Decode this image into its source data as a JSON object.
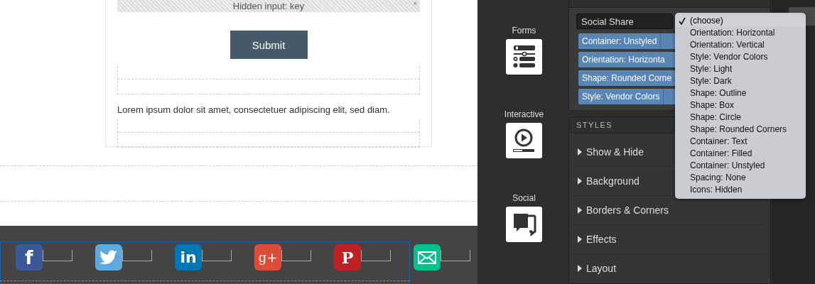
{
  "canvas": {
    "hidden_input": {
      "label": "Hidden input: key",
      "required_mark": "*"
    },
    "submit_button": "Submit",
    "paragraph": "Lorem ipsum dolor sit amet, consectetuer adipiscing elit, sed diam.",
    "social_buttons": [
      {
        "kind": "facebook",
        "color": "#3b5998",
        "glyph": "f"
      },
      {
        "kind": "twitter",
        "color": "#5ea9dd"
      },
      {
        "kind": "linkedin",
        "color": "#0077b5",
        "glyph": "in"
      },
      {
        "kind": "googleplus",
        "color": "#dd4b39",
        "glyph": "g+"
      },
      {
        "kind": "pinterest",
        "color": "#bd2126",
        "glyph": "P"
      },
      {
        "kind": "email",
        "color": "#00c18c"
      }
    ]
  },
  "widgets": [
    {
      "label": "Forms",
      "kind": "forms"
    },
    {
      "label": "Interactive",
      "kind": "interactive"
    },
    {
      "label": "Social",
      "kind": "social"
    }
  ],
  "micro_themes": {
    "select": "Social Share",
    "chips": [
      "Container: Unstyled",
      "Orientation: Horizonta",
      "Shape: Rounded Corne",
      "Style: Vendor Colors"
    ]
  },
  "styles": {
    "title": "STYLES",
    "sections": [
      {
        "label": "Show & Hide",
        "expanded": false
      },
      {
        "label": "Background",
        "expanded": false
      },
      {
        "label": "Borders & Corners",
        "expanded": false
      },
      {
        "label": "Effects",
        "expanded": false
      },
      {
        "label": "Layout",
        "expanded": false
      }
    ]
  },
  "dropdown": [
    {
      "label": "(choose)",
      "selected": true
    },
    {
      "label": "Orientation: Horizontal",
      "selected": false
    },
    {
      "label": "Orientation: Vertical",
      "selected": false
    },
    {
      "label": "Style: Vendor Colors",
      "selected": false
    },
    {
      "label": "Style: Light",
      "selected": false
    },
    {
      "label": "Style: Dark",
      "selected": false
    },
    {
      "label": "Shape: Outline",
      "selected": false
    },
    {
      "label": "Shape: Box",
      "selected": false
    },
    {
      "label": "Shape: Circle",
      "selected": false
    },
    {
      "label": "Shape: Rounded Corners",
      "selected": false
    },
    {
      "label": "Container: Text",
      "selected": false
    },
    {
      "label": "Container: Filled",
      "selected": false
    },
    {
      "label": "Container: Unstyled",
      "selected": false
    },
    {
      "label": "Spacing: None",
      "selected": false
    },
    {
      "label": "Icons: Hidden",
      "selected": false
    }
  ]
}
